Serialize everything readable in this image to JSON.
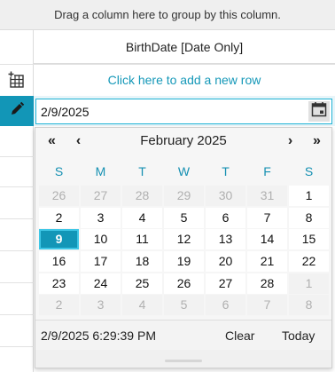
{
  "grid": {
    "group_panel_text": "Drag a column here to group by this column.",
    "column_header": "BirthDate [Date Only]",
    "add_row_text": "Click here to add a new row",
    "edit_value": "2/9/2025"
  },
  "calendar": {
    "month_title": "February 2025",
    "nav": {
      "prev_year": "«",
      "prev_month": "‹",
      "next_month": "›",
      "next_year": "»"
    },
    "weekdays": [
      "S",
      "M",
      "T",
      "W",
      "T",
      "F",
      "S"
    ],
    "weeks": [
      [
        {
          "d": "26",
          "o": true
        },
        {
          "d": "27",
          "o": true
        },
        {
          "d": "28",
          "o": true
        },
        {
          "d": "29",
          "o": true
        },
        {
          "d": "30",
          "o": true
        },
        {
          "d": "31",
          "o": true
        },
        {
          "d": "1",
          "o": false
        }
      ],
      [
        {
          "d": "2",
          "o": false
        },
        {
          "d": "3",
          "o": false
        },
        {
          "d": "4",
          "o": false
        },
        {
          "d": "5",
          "o": false
        },
        {
          "d": "6",
          "o": false
        },
        {
          "d": "7",
          "o": false
        },
        {
          "d": "8",
          "o": false
        }
      ],
      [
        {
          "d": "9",
          "o": false,
          "s": true
        },
        {
          "d": "10",
          "o": false
        },
        {
          "d": "11",
          "o": false
        },
        {
          "d": "12",
          "o": false
        },
        {
          "d": "13",
          "o": false
        },
        {
          "d": "14",
          "o": false
        },
        {
          "d": "15",
          "o": false
        }
      ],
      [
        {
          "d": "16",
          "o": false
        },
        {
          "d": "17",
          "o": false
        },
        {
          "d": "18",
          "o": false
        },
        {
          "d": "19",
          "o": false
        },
        {
          "d": "20",
          "o": false
        },
        {
          "d": "21",
          "o": false
        },
        {
          "d": "22",
          "o": false
        }
      ],
      [
        {
          "d": "23",
          "o": false
        },
        {
          "d": "24",
          "o": false
        },
        {
          "d": "25",
          "o": false
        },
        {
          "d": "26",
          "o": false
        },
        {
          "d": "27",
          "o": false
        },
        {
          "d": "28",
          "o": false
        },
        {
          "d": "1",
          "o": true
        }
      ],
      [
        {
          "d": "2",
          "o": true
        },
        {
          "d": "3",
          "o": true
        },
        {
          "d": "4",
          "o": true
        },
        {
          "d": "5",
          "o": true
        },
        {
          "d": "6",
          "o": true
        },
        {
          "d": "7",
          "o": true
        },
        {
          "d": "8",
          "o": true
        }
      ]
    ],
    "footer_datetime": "2/9/2025 6:29:39 PM",
    "clear_label": "Clear",
    "today_label": "Today"
  },
  "colors": {
    "accent": "#1296b7",
    "link": "#1598b8",
    "weekday": "#1590b2"
  },
  "icons": {
    "add_row": "table-add-icon",
    "edit": "pencil-icon",
    "calendar": "calendar-icon"
  }
}
